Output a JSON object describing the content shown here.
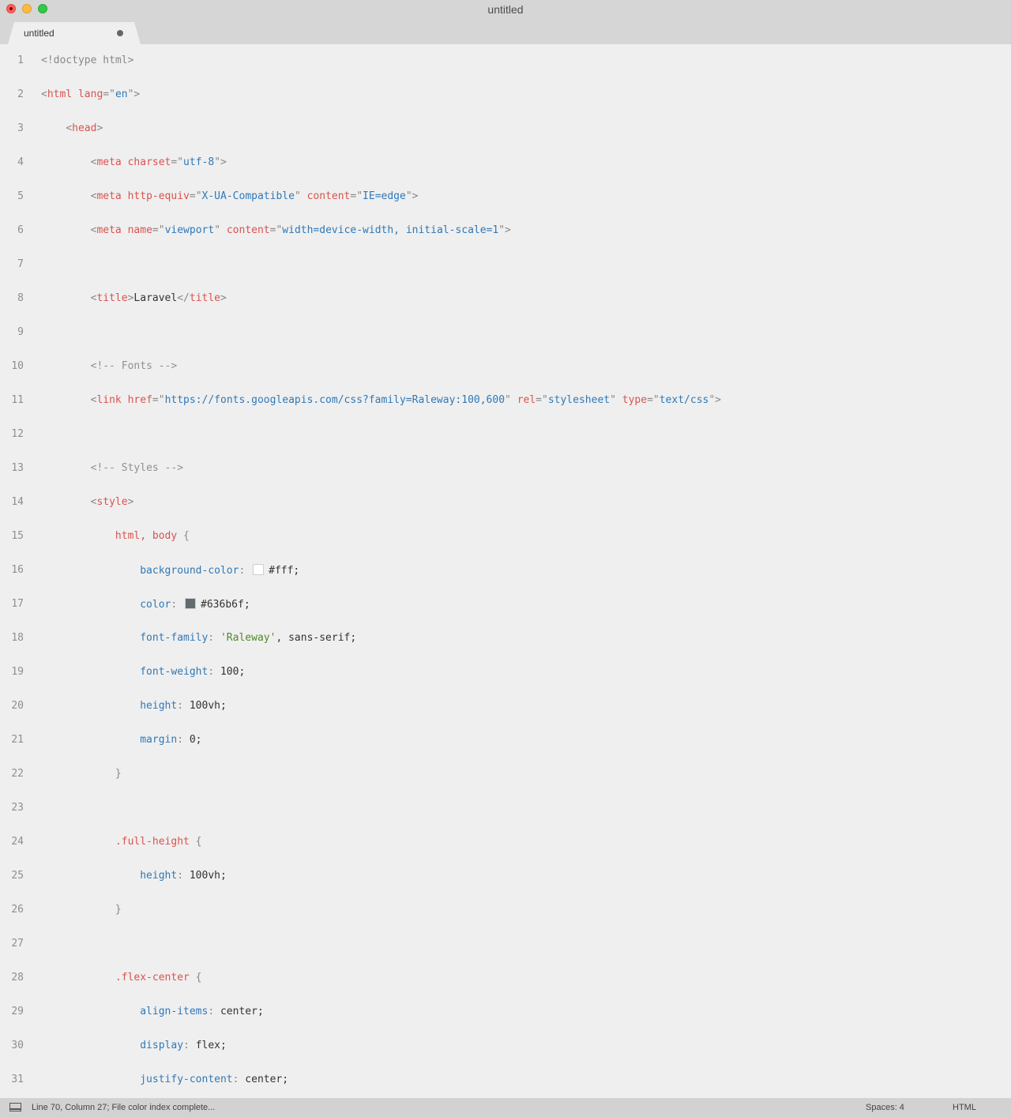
{
  "window": {
    "title": "untitled"
  },
  "tab": {
    "label": "untitled"
  },
  "swatches": {
    "fff": "#ffffff",
    "636b6f": "#636b6f"
  },
  "lines": [
    {
      "n": "1",
      "p": [
        [
          "p",
          "<!doctype html>"
        ]
      ]
    },
    {
      "n": "2",
      "p": [
        [
          "p",
          "<"
        ],
        [
          "t",
          "html"
        ],
        [
          "v",
          " "
        ],
        [
          "a",
          "lang"
        ],
        [
          "p",
          "=\""
        ],
        [
          "s",
          "en"
        ],
        [
          "p",
          "\">"
        ]
      ]
    },
    {
      "n": "3",
      "p": [
        [
          "v",
          "    "
        ],
        [
          "p",
          "<"
        ],
        [
          "t",
          "head"
        ],
        [
          "p",
          ">"
        ]
      ]
    },
    {
      "n": "4",
      "p": [
        [
          "v",
          "        "
        ],
        [
          "p",
          "<"
        ],
        [
          "t",
          "meta"
        ],
        [
          "v",
          " "
        ],
        [
          "a",
          "charset"
        ],
        [
          "p",
          "=\""
        ],
        [
          "s",
          "utf-8"
        ],
        [
          "p",
          "\">"
        ]
      ]
    },
    {
      "n": "5",
      "p": [
        [
          "v",
          "        "
        ],
        [
          "p",
          "<"
        ],
        [
          "t",
          "meta"
        ],
        [
          "v",
          " "
        ],
        [
          "a",
          "http-equiv"
        ],
        [
          "p",
          "=\""
        ],
        [
          "s",
          "X-UA-Compatible"
        ],
        [
          "p",
          "\""
        ],
        [
          "v",
          " "
        ],
        [
          "a",
          "content"
        ],
        [
          "p",
          "=\""
        ],
        [
          "s",
          "IE=edge"
        ],
        [
          "p",
          "\">"
        ]
      ]
    },
    {
      "n": "6",
      "p": [
        [
          "v",
          "        "
        ],
        [
          "p",
          "<"
        ],
        [
          "t",
          "meta"
        ],
        [
          "v",
          " "
        ],
        [
          "a",
          "name"
        ],
        [
          "p",
          "=\""
        ],
        [
          "s",
          "viewport"
        ],
        [
          "p",
          "\""
        ],
        [
          "v",
          " "
        ],
        [
          "a",
          "content"
        ],
        [
          "p",
          "=\""
        ],
        [
          "s",
          "width=device-width, initial-scale=1"
        ],
        [
          "p",
          "\">"
        ]
      ]
    },
    {
      "n": "7",
      "p": []
    },
    {
      "n": "8",
      "p": [
        [
          "v",
          "        "
        ],
        [
          "p",
          "<"
        ],
        [
          "t",
          "title"
        ],
        [
          "p",
          ">"
        ],
        [
          "v",
          "Laravel"
        ],
        [
          "p",
          "</"
        ],
        [
          "t",
          "title"
        ],
        [
          "p",
          ">"
        ]
      ]
    },
    {
      "n": "9",
      "p": []
    },
    {
      "n": "10",
      "p": [
        [
          "v",
          "        "
        ],
        [
          "c",
          "<!-- Fonts -->"
        ]
      ]
    },
    {
      "n": "11",
      "p": [
        [
          "v",
          "        "
        ],
        [
          "p",
          "<"
        ],
        [
          "t",
          "link"
        ],
        [
          "v",
          " "
        ],
        [
          "a",
          "href"
        ],
        [
          "p",
          "=\""
        ],
        [
          "s",
          "https://fonts.googleapis.com/css?family=Raleway:100,600"
        ],
        [
          "p",
          "\""
        ],
        [
          "v",
          " "
        ],
        [
          "a",
          "rel"
        ],
        [
          "p",
          "=\""
        ],
        [
          "s",
          "stylesheet"
        ],
        [
          "p",
          "\""
        ],
        [
          "v",
          " "
        ],
        [
          "a",
          "type"
        ],
        [
          "p",
          "=\""
        ],
        [
          "s",
          "text/css"
        ],
        [
          "p",
          "\">"
        ]
      ]
    },
    {
      "n": "12",
      "p": []
    },
    {
      "n": "13",
      "p": [
        [
          "v",
          "        "
        ],
        [
          "c",
          "<!-- Styles -->"
        ]
      ]
    },
    {
      "n": "14",
      "p": [
        [
          "v",
          "        "
        ],
        [
          "p",
          "<"
        ],
        [
          "t",
          "style"
        ],
        [
          "p",
          ">"
        ]
      ]
    },
    {
      "n": "15",
      "p": [
        [
          "v",
          "            "
        ],
        [
          "sel",
          "html, body"
        ],
        [
          "v",
          " "
        ],
        [
          "p",
          "{"
        ]
      ]
    },
    {
      "n": "16",
      "p": [
        [
          "v",
          "                "
        ],
        [
          "pr",
          "background-color"
        ],
        [
          "p",
          ": "
        ],
        [
          "sw",
          "fff"
        ],
        [
          "v",
          "#fff;"
        ]
      ]
    },
    {
      "n": "17",
      "p": [
        [
          "v",
          "                "
        ],
        [
          "pr",
          "color"
        ],
        [
          "p",
          ": "
        ],
        [
          "sw",
          "636b6f"
        ],
        [
          "v",
          "#636b6f;"
        ]
      ]
    },
    {
      "n": "18",
      "p": [
        [
          "v",
          "                "
        ],
        [
          "pr",
          "font-family"
        ],
        [
          "p",
          ": "
        ],
        [
          "q",
          "'Raleway'"
        ],
        [
          "v",
          ", sans-serif;"
        ]
      ]
    },
    {
      "n": "19",
      "p": [
        [
          "v",
          "                "
        ],
        [
          "pr",
          "font-weight"
        ],
        [
          "p",
          ": "
        ],
        [
          "v",
          "100;"
        ]
      ]
    },
    {
      "n": "20",
      "p": [
        [
          "v",
          "                "
        ],
        [
          "pr",
          "height"
        ],
        [
          "p",
          ": "
        ],
        [
          "v",
          "100vh;"
        ]
      ]
    },
    {
      "n": "21",
      "p": [
        [
          "v",
          "                "
        ],
        [
          "pr",
          "margin"
        ],
        [
          "p",
          ": "
        ],
        [
          "v",
          "0;"
        ]
      ]
    },
    {
      "n": "22",
      "p": [
        [
          "v",
          "            "
        ],
        [
          "p",
          "}"
        ]
      ]
    },
    {
      "n": "23",
      "p": []
    },
    {
      "n": "24",
      "p": [
        [
          "v",
          "            "
        ],
        [
          "sel",
          ".full-height"
        ],
        [
          "v",
          " "
        ],
        [
          "p",
          "{"
        ]
      ]
    },
    {
      "n": "25",
      "p": [
        [
          "v",
          "                "
        ],
        [
          "pr",
          "height"
        ],
        [
          "p",
          ": "
        ],
        [
          "v",
          "100vh;"
        ]
      ]
    },
    {
      "n": "26",
      "p": [
        [
          "v",
          "            "
        ],
        [
          "p",
          "}"
        ]
      ]
    },
    {
      "n": "27",
      "p": []
    },
    {
      "n": "28",
      "p": [
        [
          "v",
          "            "
        ],
        [
          "sel",
          ".flex-center"
        ],
        [
          "v",
          " "
        ],
        [
          "p",
          "{"
        ]
      ]
    },
    {
      "n": "29",
      "p": [
        [
          "v",
          "                "
        ],
        [
          "pr",
          "align-items"
        ],
        [
          "p",
          ": "
        ],
        [
          "v",
          "center;"
        ]
      ]
    },
    {
      "n": "30",
      "p": [
        [
          "v",
          "                "
        ],
        [
          "pr",
          "display"
        ],
        [
          "p",
          ": "
        ],
        [
          "v",
          "flex;"
        ]
      ]
    },
    {
      "n": "31",
      "p": [
        [
          "v",
          "                "
        ],
        [
          "pr",
          "justify-content"
        ],
        [
          "p",
          ": "
        ],
        [
          "v",
          "center;"
        ]
      ]
    }
  ],
  "status": {
    "message": "Line 70, Column 27; File color index complete...",
    "spaces": "Spaces: 4",
    "syntax": "HTML"
  }
}
